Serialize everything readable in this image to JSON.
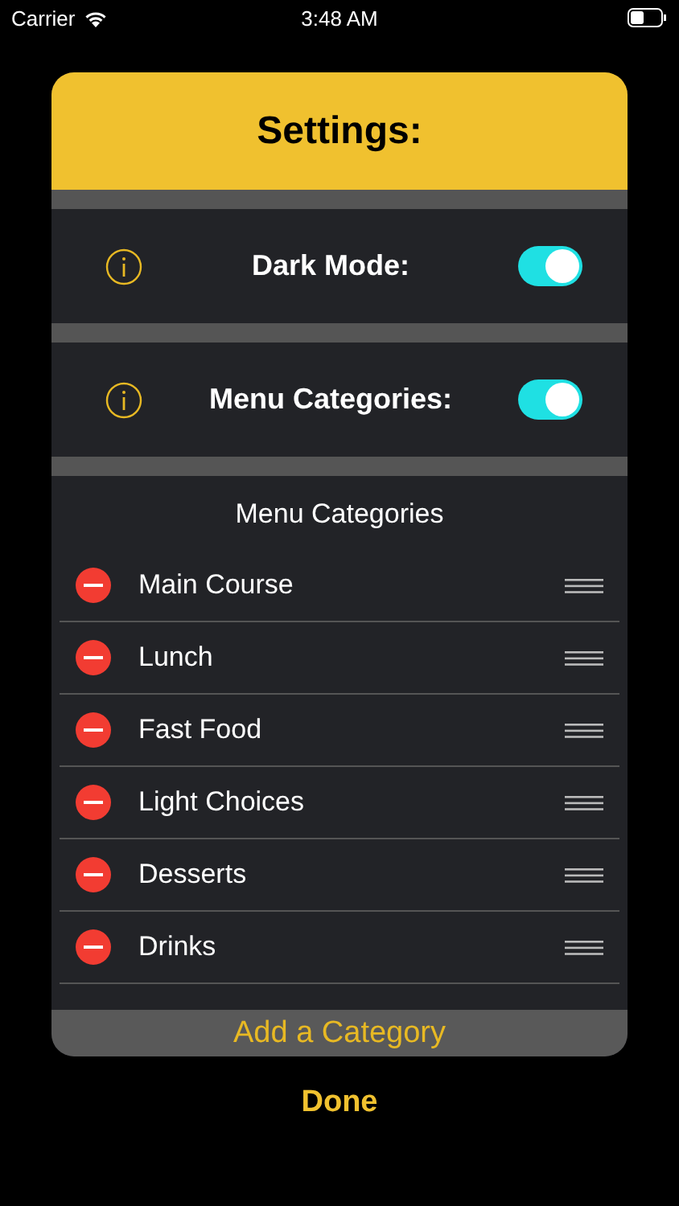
{
  "status_bar": {
    "carrier": "Carrier",
    "time": "3:48 AM"
  },
  "title": "Settings:",
  "settings": [
    {
      "label": "Dark Mode:",
      "on": true
    },
    {
      "label": "Menu Categories:",
      "on": true
    }
  ],
  "categories": {
    "heading": "Menu Categories",
    "items": [
      {
        "label": "Main Course"
      },
      {
        "label": "Lunch"
      },
      {
        "label": "Fast Food"
      },
      {
        "label": "Light Choices"
      },
      {
        "label": "Desserts"
      },
      {
        "label": "Drinks"
      }
    ]
  },
  "add_button": "Add a Category",
  "done_button": "Done"
}
